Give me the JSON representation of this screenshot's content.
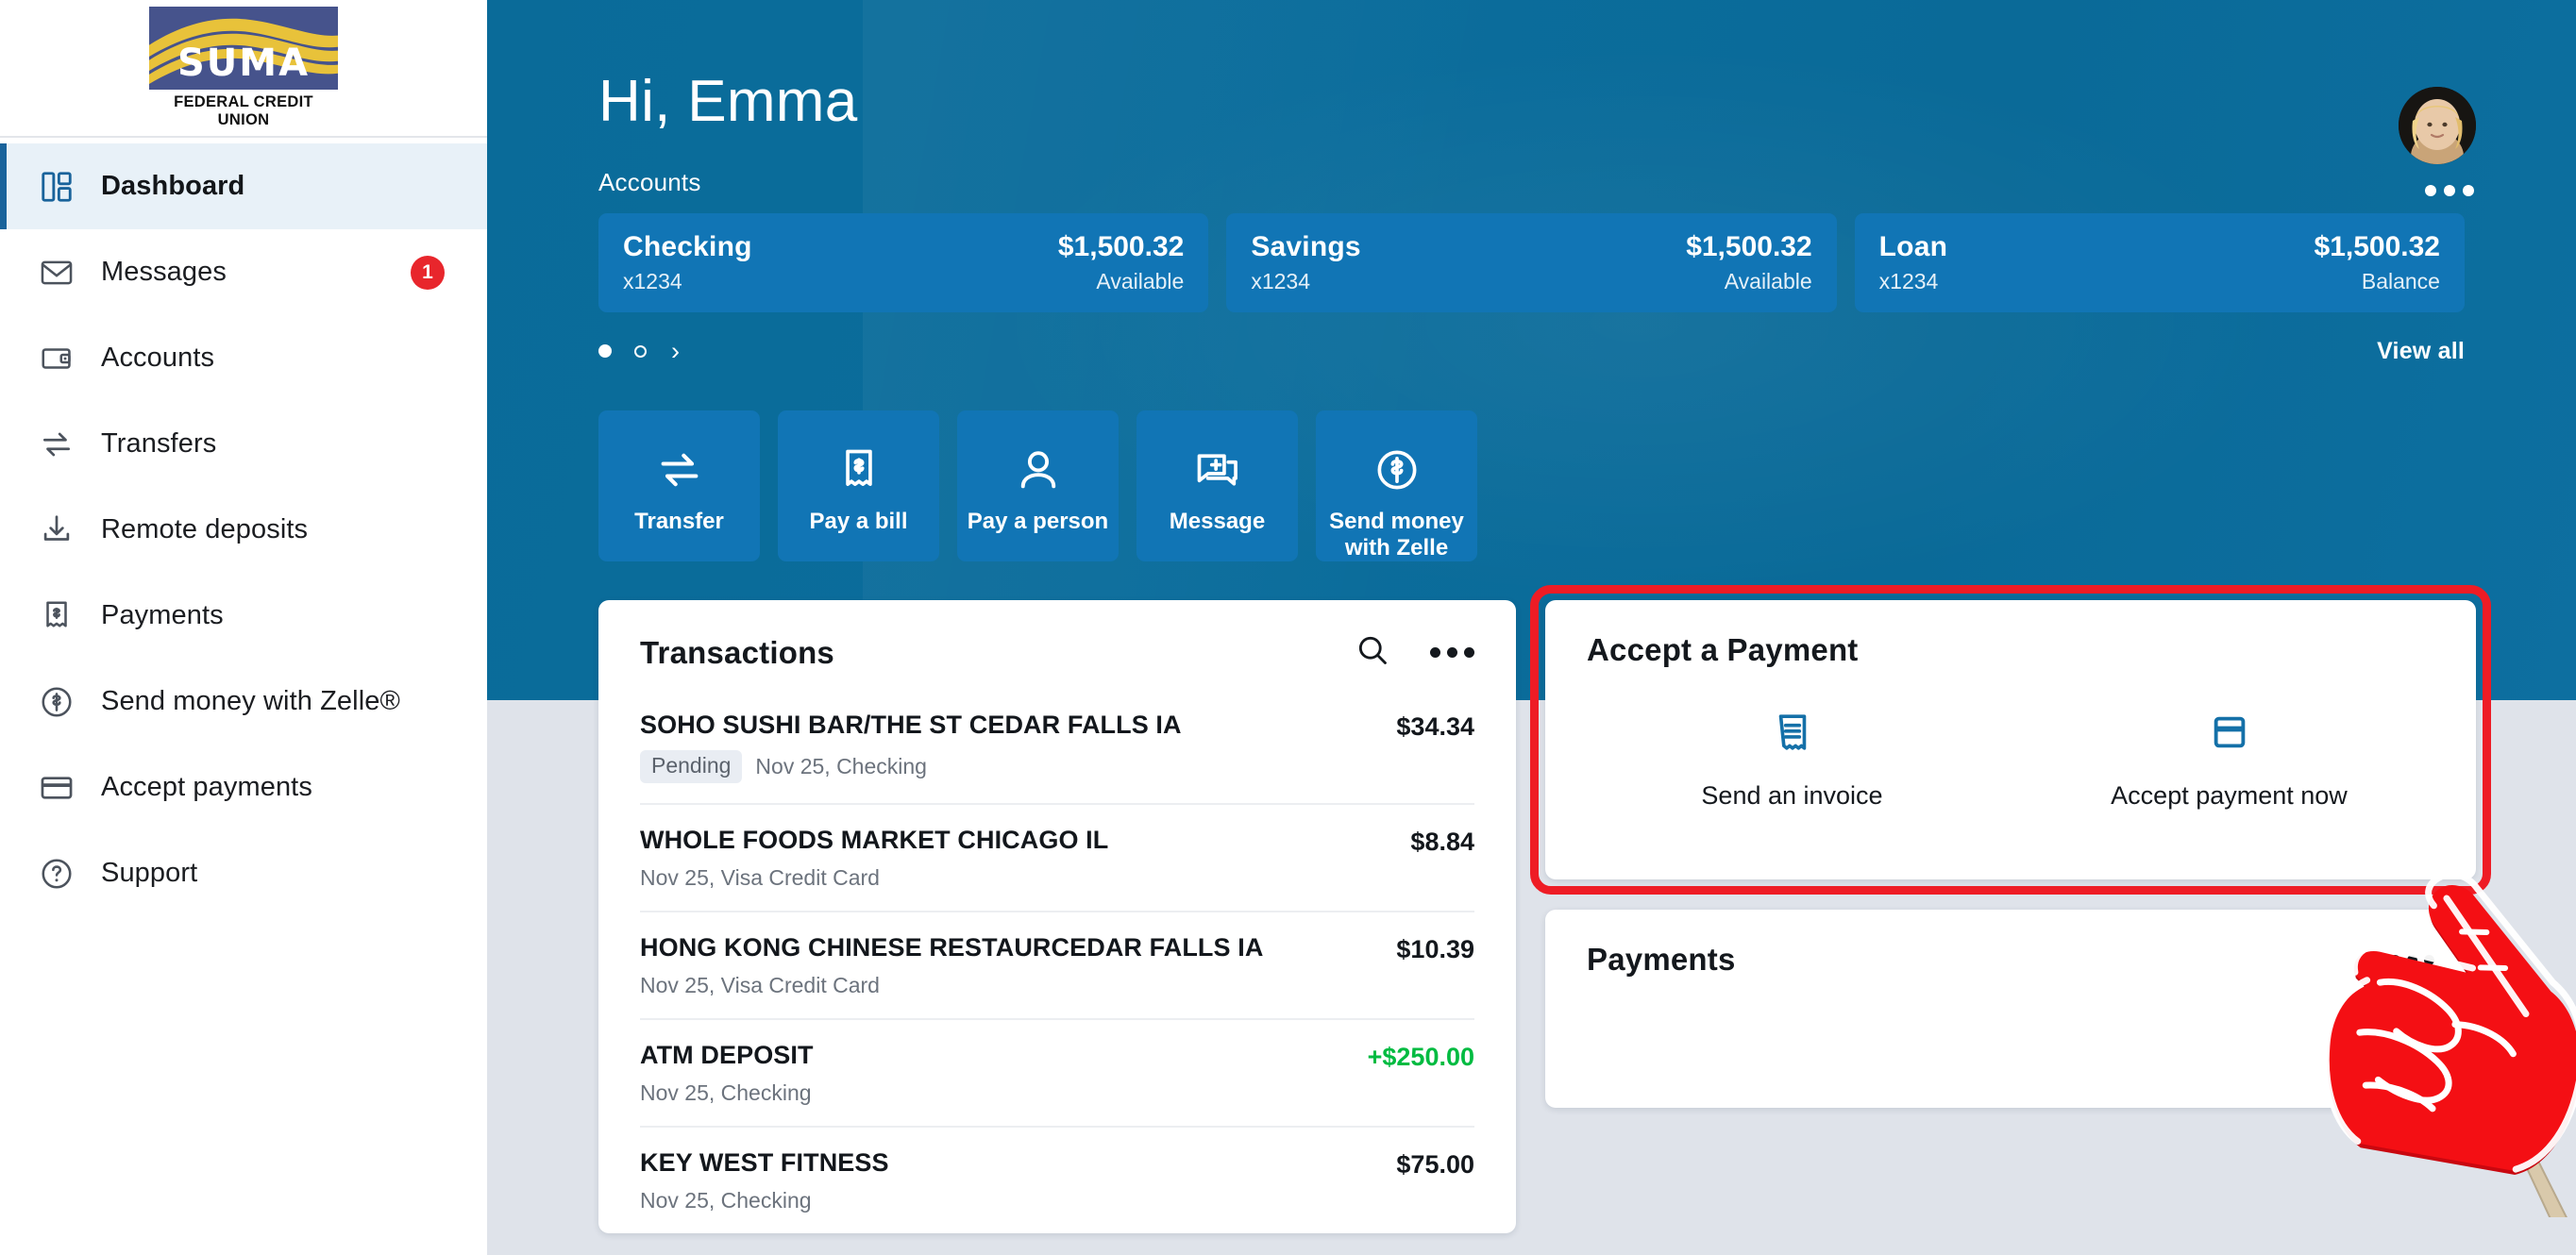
{
  "brand": {
    "logo_word": "SUMA",
    "logo_subtitle": "FEDERAL CREDIT UNION",
    "logo_bg": "#46538c",
    "logo_wave": "#e8c23a",
    "accent": "#0b6d9c",
    "card_blue": "#1175b5",
    "highlight_red": "#ee1c25",
    "credit_green": "#00bb41",
    "badge_red": "#e8262c"
  },
  "sidebar": {
    "items": [
      {
        "label": "Dashboard",
        "icon": "dashboard-grid-icon",
        "active": true,
        "badge": ""
      },
      {
        "label": "Messages",
        "icon": "envelope-icon",
        "active": false,
        "badge": "1"
      },
      {
        "label": "Accounts",
        "icon": "wallet-icon",
        "active": false,
        "badge": ""
      },
      {
        "label": "Transfers",
        "icon": "transfer-arrows-icon",
        "active": false,
        "badge": ""
      },
      {
        "label": "Remote deposits",
        "icon": "download-icon",
        "active": false,
        "badge": ""
      },
      {
        "label": "Payments",
        "icon": "bill-dollar-icon",
        "active": false,
        "badge": ""
      },
      {
        "label": "Send money with Zelle®",
        "icon": "dollar-circle-icon",
        "active": false,
        "badge": ""
      },
      {
        "label": "Accept payments",
        "icon": "credit-card-icon",
        "active": false,
        "badge": ""
      },
      {
        "label": "Support",
        "icon": "question-circle-icon",
        "active": false,
        "badge": ""
      }
    ]
  },
  "header": {
    "greeting": "Hi, Emma",
    "accounts_label": "Accounts",
    "view_all": "View all"
  },
  "accounts": [
    {
      "name": "Checking",
      "number": "x1234",
      "balance": "$1,500.32",
      "sublabel": "Available"
    },
    {
      "name": "Savings",
      "number": "x1234",
      "balance": "$1,500.32",
      "sublabel": "Available"
    },
    {
      "name": "Loan",
      "number": "x1234",
      "balance": "$1,500.32",
      "sublabel": "Balance"
    }
  ],
  "quick_actions": [
    {
      "label": "Transfer",
      "icon": "transfer-arrows-icon"
    },
    {
      "label": "Pay a bill",
      "icon": "bill-dollar-icon"
    },
    {
      "label": "Pay a person",
      "icon": "person-icon"
    },
    {
      "label": "Message",
      "icon": "message-plus-icon"
    },
    {
      "label": "Send money\nwith Zelle",
      "icon": "dollar-circle-icon"
    }
  ],
  "transactions": {
    "title": "Transactions",
    "rows": [
      {
        "desc": "SOHO SUSHI BAR/THE ST CEDAR FALLS IA",
        "badge": "Pending",
        "sub": "Nov 25, Checking",
        "amount": "$34.34",
        "credit": false
      },
      {
        "desc": "WHOLE FOODS MARKET CHICAGO IL",
        "badge": "",
        "sub": "Nov 25, Visa Credit Card",
        "amount": "$8.84",
        "credit": false
      },
      {
        "desc": "HONG KONG CHINESE RESTAURCEDAR FALLS IA",
        "badge": "",
        "sub": "Nov 25, Visa Credit Card",
        "amount": "$10.39",
        "credit": false
      },
      {
        "desc": "ATM DEPOSIT",
        "badge": "",
        "sub": "Nov 25, Checking",
        "amount": "+$250.00",
        "credit": true
      },
      {
        "desc": "KEY WEST FITNESS",
        "badge": "",
        "sub": "Nov 25, Checking",
        "amount": "$75.00",
        "credit": false
      }
    ]
  },
  "accept_payment": {
    "title": "Accept a Payment",
    "options": [
      {
        "label": "Send an invoice",
        "icon": "receipt-icon"
      },
      {
        "label": "Accept payment now",
        "icon": "credit-card-icon"
      }
    ]
  },
  "payments_panel": {
    "title": "Payments"
  },
  "cursor": {
    "type": "foam-finger-pointer"
  }
}
